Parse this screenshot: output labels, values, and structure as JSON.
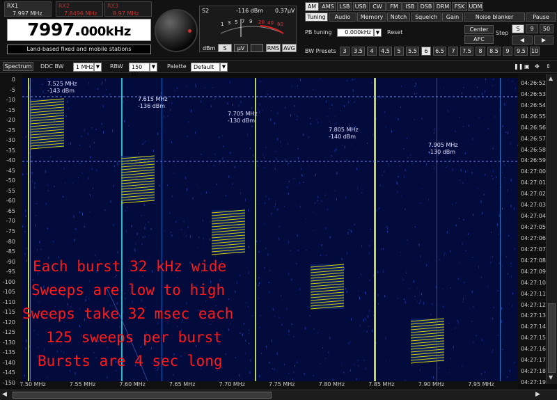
{
  "receivers": [
    {
      "name": "RX1",
      "freq": "7.997 MHz",
      "active": true
    },
    {
      "name": "RX2",
      "freq": "7.8496 MHz",
      "active": false
    },
    {
      "name": "RX3",
      "freq": "8.97 MHz",
      "active": false
    }
  ],
  "main_freq": {
    "value": "7997.",
    "suffix": "000kHz"
  },
  "description": "Land-based fixed and mobile stations",
  "smeter": {
    "label": "S2",
    "dbm": "-116 dBm",
    "volts": "0.37µV",
    "scale": [
      "1",
      "3",
      "5",
      "7",
      "9",
      "20",
      "40",
      "60"
    ],
    "mode_buttons": [
      "dBm",
      "S",
      "µV"
    ],
    "selected_unit": "S",
    "rms": "RMS",
    "avg": "AVG"
  },
  "modes": [
    "AM",
    "AMS",
    "LSB",
    "USB",
    "CW",
    "FM",
    "ISB",
    "DSB",
    "DRM",
    "FSK",
    "UDM"
  ],
  "active_mode": "AM",
  "tabs": [
    "Tuning",
    "Audio",
    "Memory",
    "Notch",
    "Squelch",
    "Gain",
    "Noise blanker",
    "Pause"
  ],
  "active_tab": "Tuning",
  "pb_tuning": {
    "label": "PB tuning",
    "value": "0.000kHz",
    "reset": "Reset"
  },
  "center_label": "Center",
  "afc_label": "AFC",
  "step": {
    "label": "Step",
    "options": [
      "S",
      "9",
      "50"
    ],
    "selected": "S"
  },
  "bw_presets": {
    "label": "BW Presets",
    "values": [
      "3",
      "3.5",
      "4",
      "4.5",
      "5",
      "5.5",
      "6",
      "6.5",
      "7",
      "7.5",
      "8",
      "8.5",
      "9",
      "9.5",
      "10"
    ],
    "selected": "6"
  },
  "controls": {
    "spectrum": "Spectrum",
    "ddc_label": "DDC BW",
    "ddc_value": "1 MHz",
    "rbw_label": "RBW",
    "rbw_value": "150 Hz",
    "palette_label": "Palette",
    "palette_value": "Default"
  },
  "db_scale": [
    "0",
    "-5",
    "-10",
    "-15",
    "-20",
    "-25",
    "-30",
    "-35",
    "-40",
    "-45",
    "-50",
    "-55",
    "-60",
    "-65",
    "-70",
    "-75",
    "-80",
    "-85",
    "-90",
    "-95",
    "-100",
    "-105",
    "-110",
    "-115",
    "-120",
    "-125",
    "-130",
    "-135",
    "-140",
    "-145",
    "-150"
  ],
  "times": [
    "04:26:52",
    "04:26:53",
    "04:26:54",
    "04:26:55",
    "04:26:56",
    "04:26:57",
    "04:26:58",
    "04:26:59",
    "04:27:00",
    "04:27:01",
    "04:27:02",
    "04:27:03",
    "04:27:04",
    "04:27:05",
    "04:27:06",
    "04:27:07",
    "04:27:08",
    "04:27:09",
    "04:27:10",
    "04:27:11",
    "04:27:12",
    "04:27:13",
    "04:27:14",
    "04:27:15",
    "04:27:16",
    "04:27:17",
    "04:27:18",
    "04:27:19"
  ],
  "freq_axis": [
    "7.50 MHz",
    "7.55 MHz",
    "7.60 MHz",
    "7.65 MHz",
    "7.70 MHz",
    "7.75 MHz",
    "7.80 MHz",
    "7.85 MHz",
    "7.90 MHz",
    "7.95 MHz"
  ],
  "markers": [
    {
      "freq": "7.525 MHz",
      "level": "-143 dBm"
    },
    {
      "freq": "7.615 MHz",
      "level": "-136 dBm"
    },
    {
      "freq": "7.705 MHz",
      "level": "-130 dBm"
    },
    {
      "freq": "7.805 MHz",
      "level": "-140 dBm"
    },
    {
      "freq": "7.905 MHz",
      "level": "-130 dBm"
    }
  ],
  "annotation": [
    "Each burst 32 kHz wide",
    "Sweeps are low to high",
    "Sweeps take 32 msec each",
    "125 sweeps per burst",
    "Bursts are 4 sec long"
  ],
  "colors": {
    "waterfall_bg": "#030a3c",
    "annotation": "#ff1a1a",
    "sweep": "#d4d400",
    "carrier": "#cfe860"
  }
}
